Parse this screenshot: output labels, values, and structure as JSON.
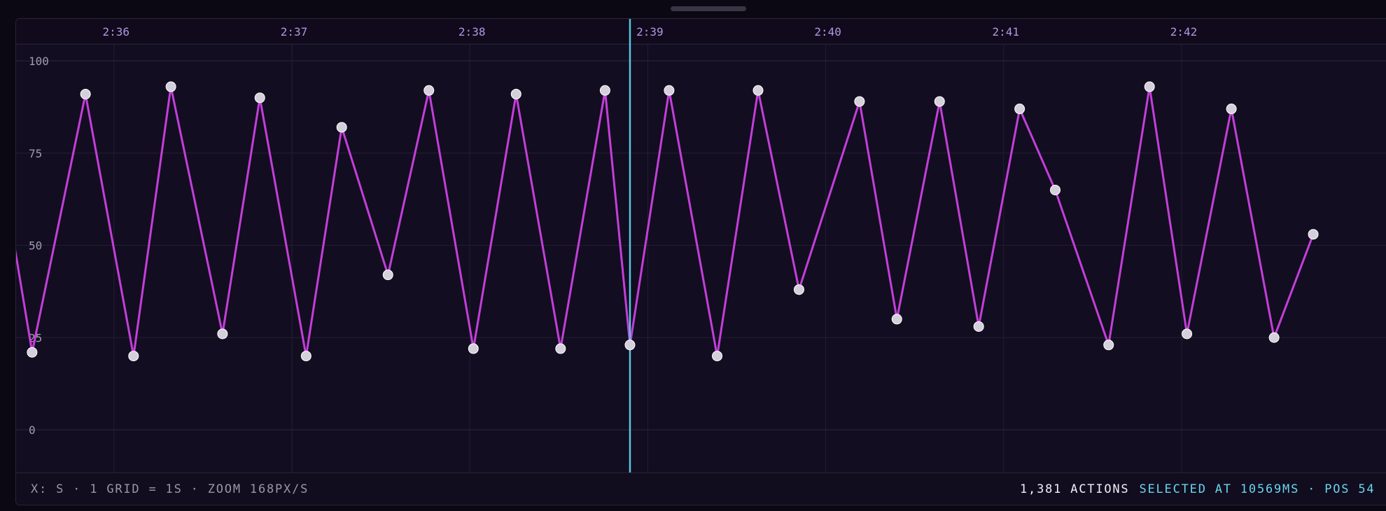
{
  "status": {
    "x_info": "X: S · 1 GRID = 1S · ZOOM 168PX/S",
    "actions": "1,381 ACTIONS",
    "selected": "SELECTED AT 10569MS · POS 54"
  },
  "colors": {
    "background": "#0b0814",
    "panel": "#130d21",
    "series_line": "#c33fd9",
    "point_fill": "#d4d0db",
    "cursor": "#56c8e0",
    "tick_text": "#b496e0",
    "axis_text": "#a09bab",
    "selected_text": "#67d6ea"
  },
  "chart_data": {
    "type": "line",
    "x_unit": "s",
    "x_tick_labels": [
      "2:36",
      "2:37",
      "2:38",
      "2:39",
      "2:40",
      "2:41",
      "2:42"
    ],
    "x_tick_seconds": [
      156,
      157,
      158,
      159,
      160,
      161,
      162
    ],
    "x_range": [
      155.45,
      163.2
    ],
    "y_tick_labels": [
      "0",
      "25",
      "50",
      "75",
      "100"
    ],
    "ylim": [
      -9.5,
      100
    ],
    "grid": true,
    "cursor_x": 158.9,
    "series": [
      {
        "x": [
          155.44,
          155.54,
          155.84,
          156.11,
          156.32,
          156.61,
          156.82,
          157.08,
          157.28,
          157.54,
          157.77,
          158.02,
          158.26,
          158.51,
          158.76,
          158.9,
          159.12,
          159.39,
          159.62,
          159.85,
          160.19,
          160.4,
          160.64,
          160.86,
          161.09,
          161.29,
          161.59,
          161.82,
          162.03,
          162.28,
          162.52,
          162.74
        ],
        "y": [
          50,
          21,
          91,
          20,
          93,
          26,
          90,
          20,
          82,
          42,
          92,
          22,
          91,
          22,
          92,
          23,
          92,
          20,
          92,
          38,
          89,
          30,
          89,
          28,
          87,
          65,
          23,
          93,
          26,
          87,
          25,
          53
        ]
      }
    ]
  }
}
